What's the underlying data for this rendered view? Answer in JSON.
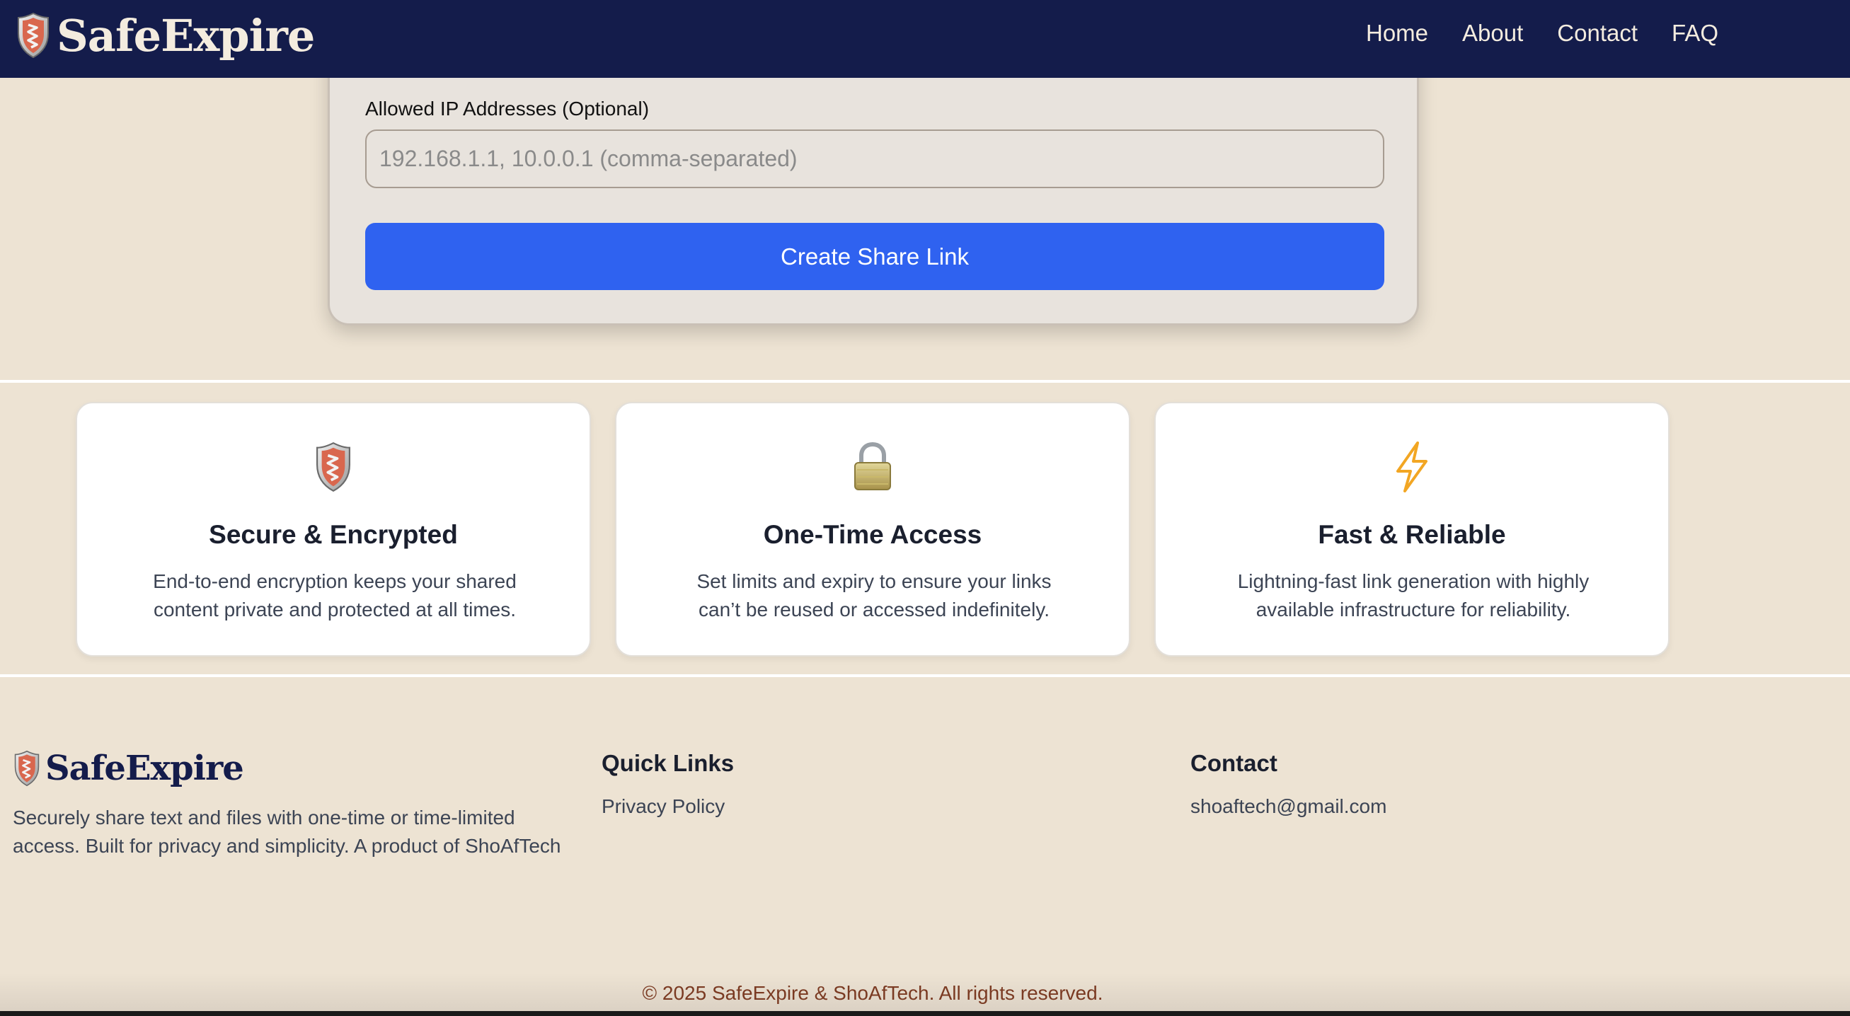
{
  "navbar": {
    "brand": "SafeExpire",
    "logo_icon": "shield-icon",
    "links": [
      "Home",
      "About",
      "Contact",
      "FAQ"
    ]
  },
  "form": {
    "ip_label": "Allowed IP Addresses (Optional)",
    "ip_placeholder": "192.168.1.1, 10.0.0.1 (comma-separated)",
    "ip_value": "",
    "submit_label": "Create Share Link",
    "submit_color": "#2f62f0"
  },
  "features": [
    {
      "icon": "shield-icon",
      "title": "Secure & Encrypted",
      "description": "End-to-end encryption keeps your shared content private and protected at all times."
    },
    {
      "icon": "lock-icon",
      "title": "One-Time Access",
      "description": "Set limits and expiry to ensure your links can’t be reused or accessed indefinitely."
    },
    {
      "icon": "lightning-icon",
      "title": "Fast & Reliable",
      "description": "Lightning-fast link generation with highly available infrastructure for reliability."
    }
  ],
  "footer": {
    "brand": "SafeExpire",
    "description": "Securely share text and files with one-time or time-limited access. Built for privacy and simplicity. A product of ShoAfTech",
    "quick_links_heading": "Quick Links",
    "quick_links": [
      "Privacy Policy"
    ],
    "contact_heading": "Contact",
    "contact_email": "shoaftech@gmail.com",
    "copyright": "© 2025 SafeExpire & ShoAfTech. All rights reserved."
  },
  "colors": {
    "navbar_bg": "#141c4b",
    "page_bg": "#ede3d3",
    "brand_text": "#f4ecdf",
    "button": "#2f62f0",
    "copyright": "#7a3a22"
  }
}
